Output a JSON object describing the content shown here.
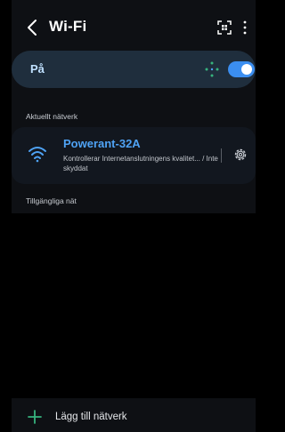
{
  "header": {
    "title": "Wi-Fi",
    "back_icon": "chevron-left-icon",
    "qr_icon": "qr-scan-icon",
    "more_icon": "more-vertical-icon"
  },
  "wifi_toggle": {
    "label": "På",
    "state": "on",
    "accent_color": "#3b8ef0"
  },
  "current_network": {
    "section_label": "Aktuellt nätverk",
    "name": "Powerant-32A",
    "status": "Kontrollerar Internetanslutningens kvalitet... / Inte skyddat",
    "icon": "wifi-icon",
    "settings_icon": "gear-icon"
  },
  "available_networks": {
    "section_label": "Tillgängliga nät"
  },
  "add_network": {
    "label": "Lägg till nätverk",
    "icon": "plus-icon",
    "icon_color": "#36b37e"
  }
}
